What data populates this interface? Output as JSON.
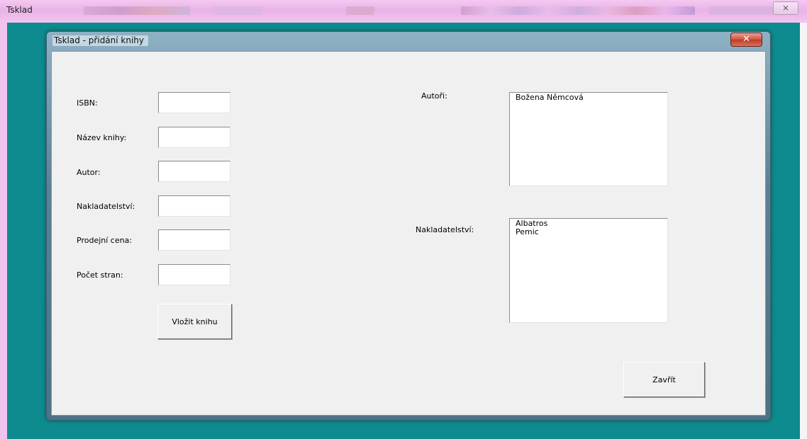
{
  "app": {
    "title": "Tsklad",
    "close_glyph": "⨯"
  },
  "dialog": {
    "title": "Tsklad - přidání knihy",
    "close_glyph": "✕",
    "fields": [
      {
        "label": "ISBN:",
        "value": ""
      },
      {
        "label": "Název knihy:",
        "value": ""
      },
      {
        "label": "Autor:",
        "value": ""
      },
      {
        "label": "Nakladatelství:",
        "value": ""
      },
      {
        "label": "Prodejní cena:",
        "value": ""
      },
      {
        "label": "Počet stran:",
        "value": ""
      }
    ],
    "insert_button": "Vložit knihu",
    "authors": {
      "label": "Autoři:",
      "items": [
        "Božena Němcová"
      ]
    },
    "publishers": {
      "label": "Nakladatelství:",
      "items": [
        "Albatros",
        "Pemic"
      ]
    },
    "close_button": "Zavřít"
  },
  "colors": {
    "desktop": "#0e8b8e",
    "app_titlebar": "#e9b3e8",
    "dialog_body": "#f0f0f0",
    "close_button_red": "#c23b22"
  }
}
